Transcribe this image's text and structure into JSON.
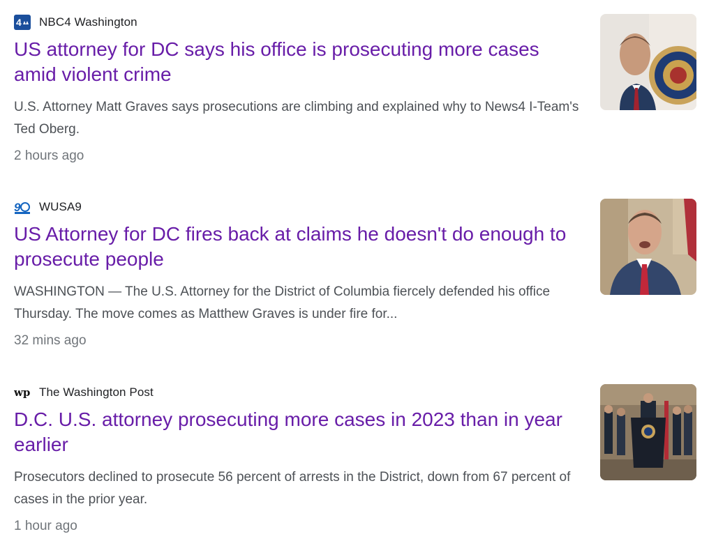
{
  "articles": [
    {
      "source": "NBC4 Washington",
      "source_icon": "nbc4-logo-icon",
      "headline": "US attorney for DC says his office is prosecuting more cases amid violent crime",
      "snippet": "U.S. Attorney Matt Graves says prosecutions are climbing and explained why to News4 I-Team's Ted Oberg.",
      "time": "2 hours ago",
      "thumbnail": "man-with-doj-seal-thumbnail"
    },
    {
      "source": "WUSA9",
      "source_icon": "wusa9-logo-icon",
      "headline": "US Attorney for DC fires back at claims he doesn't do enough to prosecute people",
      "snippet": "WASHINGTON — The U.S. Attorney for the District of Columbia fiercely defended his office Thursday. The move comes as Matthew Graves is under fire for...",
      "time": "32 mins ago",
      "thumbnail": "man-speaking-thumbnail"
    },
    {
      "source": "The Washington Post",
      "source_icon": "washington-post-logo-icon",
      "headline": "D.C. U.S. attorney prosecuting more cases in 2023 than in year earlier",
      "snippet": "Prosecutors declined to prosecute 56 percent of arrests in the District, down from 67 percent of cases in the prior year.",
      "time": "1 hour ago",
      "thumbnail": "press-conference-podium-thumbnail"
    }
  ],
  "colors": {
    "headline": "#681da8",
    "snippet": "#4d5156",
    "timestamp": "#70757a",
    "source": "#202124"
  }
}
